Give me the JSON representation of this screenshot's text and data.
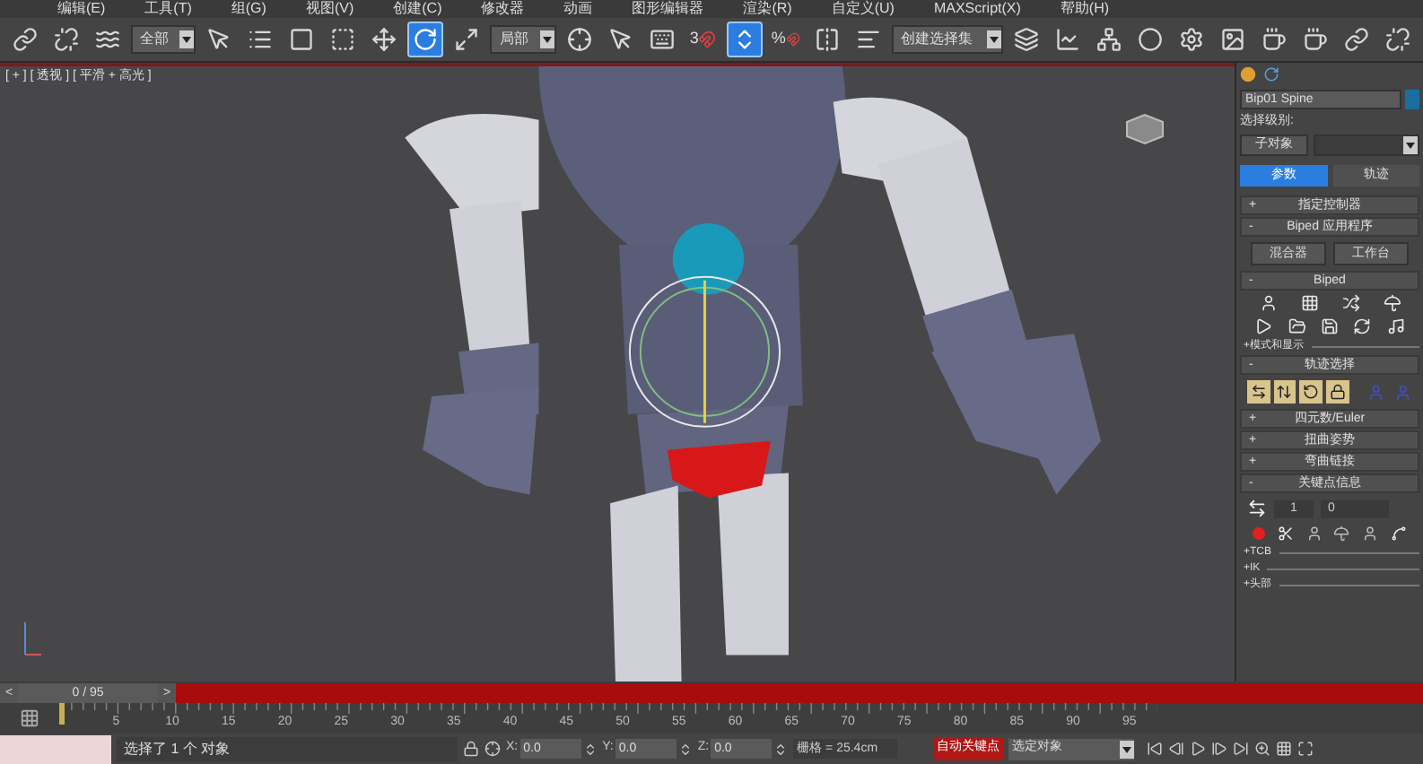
{
  "menu_bar": [
    "编辑(E)",
    "工具(T)",
    "组(G)",
    "视图(V)",
    "创建(C)",
    "修改器",
    "动画",
    "图形编辑器",
    "渲染(R)",
    "自定义(U)",
    "MAXScript(X)",
    "帮助(H)"
  ],
  "toolbar": [
    {
      "kind": "tool",
      "selected": false
    },
    {
      "kind": "tool",
      "selected": false
    },
    {
      "kind": "tool",
      "selected": false
    },
    {
      "kind": "dropdown",
      "value": "全部"
    },
    {
      "kind": "tool",
      "selected": false
    },
    {
      "kind": "tool",
      "selected": false
    },
    {
      "kind": "tool",
      "selected": false
    },
    {
      "kind": "tool",
      "selected": false
    },
    {
      "kind": "tool",
      "selected": false
    },
    {
      "kind": "tool",
      "selected": true
    },
    {
      "kind": "tool",
      "selected": false
    },
    {
      "kind": "dropdown",
      "value": "局部"
    },
    {
      "kind": "tool",
      "selected": false
    },
    {
      "kind": "tool",
      "selected": false
    },
    {
      "kind": "tool",
      "selected": false
    },
    {
      "kind": "snap",
      "label": "3",
      "selected": false
    },
    {
      "kind": "tool",
      "selected": true
    },
    {
      "kind": "snap",
      "label": "%",
      "selected": false
    },
    {
      "kind": "tool",
      "selected": false
    },
    {
      "kind": "tool",
      "selected": false
    },
    {
      "kind": "dropdown",
      "value": "创建选择集"
    },
    {
      "kind": "tool",
      "selected": false
    },
    {
      "kind": "tool",
      "selected": false
    },
    {
      "kind": "tool",
      "selected": false
    },
    {
      "kind": "tool",
      "selected": false
    },
    {
      "kind": "tool",
      "selected": false
    },
    {
      "kind": "tool",
      "selected": false
    },
    {
      "kind": "tool",
      "selected": false
    },
    {
      "kind": "tool",
      "selected": false
    },
    {
      "kind": "tool",
      "selected": false
    },
    {
      "kind": "tool",
      "selected": false
    }
  ],
  "viewport": {
    "label": "[ + ] [ 透视 ] [ 平滑 + 高光 ]"
  },
  "command_panel": {
    "object_name": "Bip01 Spine",
    "selection_level_label": "选择级别:",
    "subobject_button": "子对象",
    "tabs": [
      {
        "label": "参数",
        "selected": true
      },
      {
        "label": "轨迹",
        "selected": false
      }
    ],
    "rollouts": [
      {
        "kind": "header",
        "sign": "+",
        "title": "指定控制器"
      },
      {
        "kind": "header",
        "sign": "-",
        "title": "Biped 应用程序"
      },
      {
        "kind": "buttons",
        "buttons": [
          "混合器",
          "工作台"
        ]
      },
      {
        "kind": "header",
        "sign": "-",
        "title": "Biped"
      },
      {
        "kind": "icons_top"
      },
      {
        "kind": "icons_bottom"
      },
      {
        "kind": "sub",
        "title": "+模式和显示"
      },
      {
        "kind": "header",
        "sign": "-",
        "title": "轨迹选择"
      },
      {
        "kind": "track"
      },
      {
        "kind": "header",
        "sign": "+",
        "title": "四元数/Euler"
      },
      {
        "kind": "header",
        "sign": "+",
        "title": "扭曲姿势"
      },
      {
        "kind": "header",
        "sign": "+",
        "title": "弯曲链接"
      },
      {
        "kind": "header",
        "sign": "-",
        "title": "关键点信息"
      },
      {
        "kind": "keyfields",
        "key_number": "1",
        "key_time": "0"
      },
      {
        "kind": "keyicons"
      },
      {
        "kind": "sub",
        "title": "+TCB"
      },
      {
        "kind": "sub",
        "title": "+IK"
      },
      {
        "kind": "sub",
        "title": "+头部"
      }
    ]
  },
  "timeline": {
    "prev": "<",
    "frame": "0 / 95",
    "level": 0,
    "next": ">",
    "ruler_labels": [
      "5",
      "10",
      "15",
      "20",
      "25",
      "30",
      "35",
      "40",
      "45",
      "50",
      "55",
      "60",
      "65",
      "70",
      "75",
      "80",
      "85",
      "90",
      "95"
    ]
  },
  "status_bar": {
    "message": "选择了 1 个 对象",
    "coords": [
      {
        "axis": "X:",
        "value": "0.0"
      },
      {
        "axis": "Y:",
        "value": "0.0"
      },
      {
        "axis": "Z:",
        "value": "0.0"
      }
    ],
    "grid": "栅格 = 25.4cm",
    "auto_key": "自动关键点",
    "auto_key_on": true,
    "key_filter": "选定对象"
  }
}
